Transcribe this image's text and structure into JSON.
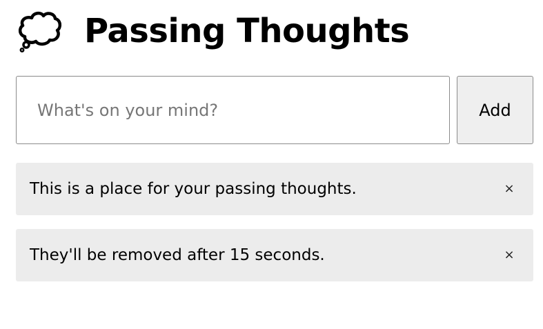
{
  "header": {
    "icon": "thought-bubble-icon",
    "title": "Passing Thoughts"
  },
  "form": {
    "input_placeholder": "What's on your mind?",
    "input_value": "",
    "add_label": "Add"
  },
  "thoughts": [
    {
      "text": "This is a place for your passing thoughts.",
      "remove_label": "×"
    },
    {
      "text": "They'll be removed after 15 seconds.",
      "remove_label": "×"
    }
  ],
  "colors": {
    "item_background": "#ececec",
    "button_background": "#efefef",
    "border": "#8a8a8a",
    "placeholder": "#767676"
  }
}
